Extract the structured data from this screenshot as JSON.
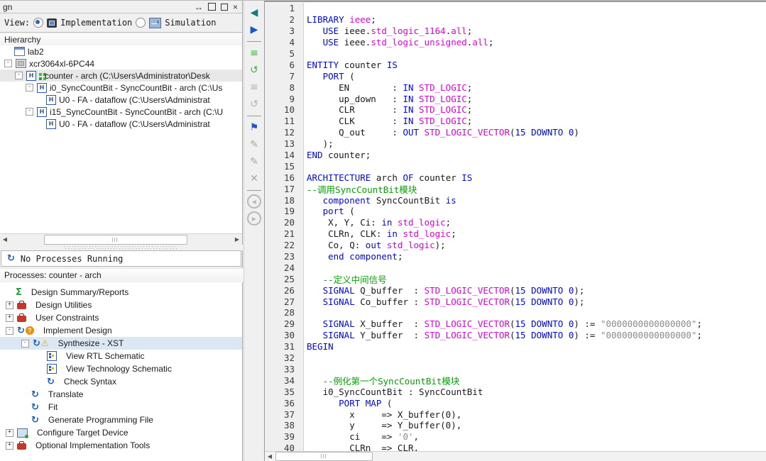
{
  "window": {
    "title_fragment": "gn",
    "buttons": [
      "float",
      "maximize",
      "restore",
      "close"
    ]
  },
  "view_bar": {
    "label": "View:",
    "options": [
      {
        "label": "Implementation",
        "selected": true,
        "icon": "implementation-chip-icon"
      },
      {
        "label": "Simulation",
        "selected": false,
        "icon": "simulation-icon"
      }
    ]
  },
  "hierarchy": {
    "header": "Hierarchy",
    "items": [
      {
        "label": "lab2",
        "depth": 1,
        "icon": "project",
        "expander": "none",
        "selected": false
      },
      {
        "label": "xcr3064xl-6PC44",
        "depth": 1,
        "icon": "device",
        "expander": "minus",
        "selected": false
      },
      {
        "label": "counter - arch (C:\\Users\\Administrator\\Desk",
        "depth": 2,
        "icon": "vhdl-top",
        "expander": "minus",
        "selected": true
      },
      {
        "label": "i0_SyncCountBit - SyncCountBit - arch (C:\\Us",
        "depth": 3,
        "icon": "vhdl",
        "expander": "minus",
        "selected": false
      },
      {
        "label": "U0 - FA - dataflow (C:\\Users\\Administrat",
        "depth": 4,
        "icon": "vhdl",
        "expander": "none",
        "selected": false
      },
      {
        "label": "i15_SyncCountBit - SyncCountBit - arch (C:\\U",
        "depth": 3,
        "icon": "vhdl",
        "expander": "minus",
        "selected": false
      },
      {
        "label": "U0 - FA - dataflow (C:\\Users\\Administrat",
        "depth": 4,
        "icon": "vhdl",
        "expander": "none",
        "selected": false
      }
    ]
  },
  "status": {
    "text": "No Processes Running",
    "icon": "refresh-icon"
  },
  "processes": {
    "header": "Processes: counter - arch",
    "items": [
      {
        "label": "Design Summary/Reports",
        "depth": 1,
        "icons": [
          "sigma"
        ],
        "expander": "none",
        "selected": false
      },
      {
        "label": "Design Utilities",
        "depth": 1,
        "icons": [
          "toolbox"
        ],
        "expander": "plus",
        "selected": false
      },
      {
        "label": "User Constraints",
        "depth": 1,
        "icons": [
          "toolbox"
        ],
        "expander": "plus",
        "selected": false
      },
      {
        "label": "Implement Design",
        "depth": 1,
        "icons": [
          "refresh",
          "question"
        ],
        "expander": "minus",
        "selected": false
      },
      {
        "label": "Synthesize - XST",
        "depth": 2,
        "icons": [
          "refresh",
          "warning"
        ],
        "expander": "minus",
        "selected": true
      },
      {
        "label": "View RTL Schematic",
        "depth": 3,
        "icons": [
          "schematic"
        ],
        "expander": "none",
        "selected": false
      },
      {
        "label": "View Technology Schematic",
        "depth": 3,
        "icons": [
          "schematic"
        ],
        "expander": "none",
        "selected": false
      },
      {
        "label": "Check Syntax",
        "depth": 3,
        "icons": [
          "refresh"
        ],
        "expander": "none",
        "selected": false
      },
      {
        "label": "Translate",
        "depth": 2,
        "icons": [
          "refresh"
        ],
        "expander": "none",
        "selected": false
      },
      {
        "label": "Fit",
        "depth": 2,
        "icons": [
          "refresh"
        ],
        "expander": "none",
        "selected": false
      },
      {
        "label": "Generate Programming File",
        "depth": 2,
        "icons": [
          "refresh"
        ],
        "expander": "none",
        "selected": false
      },
      {
        "label": "Configure Target Device",
        "depth": 1,
        "icons": [
          "target"
        ],
        "expander": "plus",
        "selected": false
      },
      {
        "label": "Optional Implementation Tools",
        "depth": 1,
        "icons": [
          "toolbox"
        ],
        "expander": "plus",
        "selected": false
      }
    ]
  },
  "editor_toolbar": {
    "items": [
      {
        "name": "goto-previous-icon",
        "glyph": "◀",
        "color": "#1a7a73"
      },
      {
        "name": "goto-next-icon",
        "glyph": "▶",
        "color": "#1a56c8"
      },
      {
        "name": "separator"
      },
      {
        "name": "process-properties-icon",
        "glyph": "≡",
        "color": "#3cb43c"
      },
      {
        "name": "reset-process-icon",
        "glyph": "↺",
        "color": "#3cb43c"
      },
      {
        "name": "process-properties-disabled-icon",
        "glyph": "≡",
        "color": "#b4b4b4"
      },
      {
        "name": "reset-all-disabled-icon",
        "glyph": "↺",
        "color": "#b4b4b4"
      },
      {
        "name": "separator"
      },
      {
        "name": "flag-icon",
        "glyph": "⚑",
        "color": "#2255cc"
      },
      {
        "name": "edit-marker-disabled-icon",
        "glyph": "✎",
        "color": "#a8a8a8"
      },
      {
        "name": "edit-marker2-disabled-icon",
        "glyph": "✎",
        "color": "#a8a8a8"
      },
      {
        "name": "delete-marker-disabled-icon",
        "glyph": "✕",
        "color": "#a8a8a8"
      },
      {
        "name": "separator"
      },
      {
        "name": "nav-back-icon",
        "glyph": "◀",
        "circle": true
      },
      {
        "name": "nav-forward-icon",
        "glyph": "▶",
        "circle": true
      }
    ]
  },
  "editor": {
    "language": "VHDL",
    "lines": [
      {
        "n": 1,
        "segs": []
      },
      {
        "n": 2,
        "segs": [
          [
            "LIBRARY ",
            "k"
          ],
          [
            "ieee",
            "t"
          ],
          [
            ";",
            "p"
          ]
        ]
      },
      {
        "n": 3,
        "segs": [
          [
            "   ",
            "p"
          ],
          [
            "USE ",
            "k"
          ],
          [
            "ieee.",
            "p"
          ],
          [
            "std_logic_1164",
            "t"
          ],
          [
            ".",
            "p"
          ],
          [
            "all",
            "t"
          ],
          [
            ";",
            "p"
          ]
        ]
      },
      {
        "n": 4,
        "segs": [
          [
            "   ",
            "p"
          ],
          [
            "USE ",
            "k"
          ],
          [
            "ieee.",
            "p"
          ],
          [
            "std_logic_unsigned",
            "t"
          ],
          [
            ".",
            "p"
          ],
          [
            "all",
            "t"
          ],
          [
            ";",
            "p"
          ]
        ]
      },
      {
        "n": 5,
        "segs": []
      },
      {
        "n": 6,
        "segs": [
          [
            "ENTITY ",
            "k"
          ],
          [
            "counter ",
            "p"
          ],
          [
            "IS",
            "k"
          ]
        ]
      },
      {
        "n": 7,
        "segs": [
          [
            "   ",
            "p"
          ],
          [
            "PORT ",
            "k"
          ],
          [
            "(",
            "p"
          ]
        ]
      },
      {
        "n": 8,
        "segs": [
          [
            "      EN        : ",
            "p"
          ],
          [
            "IN ",
            "k"
          ],
          [
            "STD_LOGIC",
            "t"
          ],
          [
            ";",
            "p"
          ]
        ]
      },
      {
        "n": 9,
        "segs": [
          [
            "      up_down   : ",
            "p"
          ],
          [
            "IN ",
            "k"
          ],
          [
            "STD_LOGIC",
            "t"
          ],
          [
            ";",
            "p"
          ]
        ]
      },
      {
        "n": 10,
        "segs": [
          [
            "      CLR       : ",
            "p"
          ],
          [
            "IN ",
            "k"
          ],
          [
            "STD_LOGIC",
            "t"
          ],
          [
            ";",
            "p"
          ]
        ]
      },
      {
        "n": 11,
        "segs": [
          [
            "      CLK       : ",
            "p"
          ],
          [
            "IN ",
            "k"
          ],
          [
            "STD_LOGIC",
            "t"
          ],
          [
            ";",
            "p"
          ]
        ]
      },
      {
        "n": 12,
        "segs": [
          [
            "      Q_out     : ",
            "p"
          ],
          [
            "OUT ",
            "k"
          ],
          [
            "STD_LOGIC_VECTOR",
            "t"
          ],
          [
            "(",
            "p"
          ],
          [
            "15",
            "n"
          ],
          [
            " ",
            "p"
          ],
          [
            "DOWNTO ",
            "k"
          ],
          [
            "0",
            "n"
          ],
          [
            ")",
            "p"
          ]
        ]
      },
      {
        "n": 13,
        "segs": [
          [
            "   );",
            "p"
          ]
        ]
      },
      {
        "n": 14,
        "segs": [
          [
            "END ",
            "k"
          ],
          [
            "counter;",
            "p"
          ]
        ]
      },
      {
        "n": 15,
        "segs": []
      },
      {
        "n": 16,
        "segs": [
          [
            "ARCHITECTURE ",
            "k"
          ],
          [
            "arch ",
            "p"
          ],
          [
            "OF ",
            "k"
          ],
          [
            "counter ",
            "p"
          ],
          [
            "IS",
            "k"
          ]
        ]
      },
      {
        "n": 17,
        "segs": [
          [
            "--调用SyncCountBit模块",
            "c"
          ]
        ]
      },
      {
        "n": 18,
        "segs": [
          [
            "   ",
            "p"
          ],
          [
            "component ",
            "k"
          ],
          [
            "SyncCountBit ",
            "p"
          ],
          [
            "is",
            "k"
          ]
        ]
      },
      {
        "n": 19,
        "segs": [
          [
            "   ",
            "p"
          ],
          [
            "port ",
            "k"
          ],
          [
            "(",
            "p"
          ]
        ]
      },
      {
        "n": 20,
        "segs": [
          [
            "    X, Y, Ci: ",
            "p"
          ],
          [
            "in ",
            "k"
          ],
          [
            "std_logic",
            "t"
          ],
          [
            ";",
            "p"
          ]
        ]
      },
      {
        "n": 21,
        "segs": [
          [
            "    CLRn, CLK: ",
            "p"
          ],
          [
            "in ",
            "k"
          ],
          [
            "std_logic",
            "t"
          ],
          [
            ";",
            "p"
          ]
        ]
      },
      {
        "n": 22,
        "segs": [
          [
            "    Co, Q: ",
            "p"
          ],
          [
            "out ",
            "k"
          ],
          [
            "std_logic",
            "t"
          ],
          [
            ");",
            "p"
          ]
        ]
      },
      {
        "n": 23,
        "segs": [
          [
            "    ",
            "p"
          ],
          [
            "end component",
            "k"
          ],
          [
            ";",
            "p"
          ]
        ]
      },
      {
        "n": 24,
        "segs": []
      },
      {
        "n": 25,
        "segs": [
          [
            "   ",
            "p"
          ],
          [
            "--定义中间信号",
            "c"
          ]
        ]
      },
      {
        "n": 26,
        "segs": [
          [
            "   ",
            "p"
          ],
          [
            "SIGNAL ",
            "k"
          ],
          [
            "Q_buffer  : ",
            "p"
          ],
          [
            "STD_LOGIC_VECTOR",
            "t"
          ],
          [
            "(",
            "p"
          ],
          [
            "15",
            "n"
          ],
          [
            " ",
            "p"
          ],
          [
            "DOWNTO ",
            "k"
          ],
          [
            "0",
            "n"
          ],
          [
            ");",
            "p"
          ]
        ]
      },
      {
        "n": 27,
        "segs": [
          [
            "   ",
            "p"
          ],
          [
            "SIGNAL ",
            "k"
          ],
          [
            "Co_buffer : ",
            "p"
          ],
          [
            "STD_LOGIC_VECTOR",
            "t"
          ],
          [
            "(",
            "p"
          ],
          [
            "15",
            "n"
          ],
          [
            " ",
            "p"
          ],
          [
            "DOWNTO ",
            "k"
          ],
          [
            "0",
            "n"
          ],
          [
            ");",
            "p"
          ]
        ]
      },
      {
        "n": 28,
        "segs": []
      },
      {
        "n": 29,
        "segs": [
          [
            "   ",
            "p"
          ],
          [
            "SIGNAL ",
            "k"
          ],
          [
            "X_buffer  : ",
            "p"
          ],
          [
            "STD_LOGIC_VECTOR",
            "t"
          ],
          [
            "(",
            "p"
          ],
          [
            "15",
            "n"
          ],
          [
            " ",
            "p"
          ],
          [
            "DOWNTO ",
            "k"
          ],
          [
            "0",
            "n"
          ],
          [
            ") := ",
            "p"
          ],
          [
            "\"0000000000000000\"",
            "s"
          ],
          [
            ";",
            "p"
          ]
        ]
      },
      {
        "n": 30,
        "segs": [
          [
            "   ",
            "p"
          ],
          [
            "SIGNAL ",
            "k"
          ],
          [
            "Y_buffer  : ",
            "p"
          ],
          [
            "STD_LOGIC_VECTOR",
            "t"
          ],
          [
            "(",
            "p"
          ],
          [
            "15",
            "n"
          ],
          [
            " ",
            "p"
          ],
          [
            "DOWNTO ",
            "k"
          ],
          [
            "0",
            "n"
          ],
          [
            ") := ",
            "p"
          ],
          [
            "\"0000000000000000\"",
            "s"
          ],
          [
            ";",
            "p"
          ]
        ]
      },
      {
        "n": 31,
        "segs": [
          [
            "BEGIN",
            "k"
          ]
        ]
      },
      {
        "n": 32,
        "segs": []
      },
      {
        "n": 33,
        "segs": []
      },
      {
        "n": 34,
        "segs": [
          [
            "   ",
            "p"
          ],
          [
            "--例化第一个SyncCountBit模块",
            "c"
          ]
        ]
      },
      {
        "n": 35,
        "segs": [
          [
            "   i0_SyncCountBit : SyncCountBit",
            "p"
          ]
        ]
      },
      {
        "n": 36,
        "segs": [
          [
            "      ",
            "p"
          ],
          [
            "PORT MAP ",
            "k"
          ],
          [
            "(",
            "p"
          ]
        ]
      },
      {
        "n": 37,
        "segs": [
          [
            "        x     => X_buffer(0),",
            "p"
          ]
        ]
      },
      {
        "n": 38,
        "segs": [
          [
            "        y     => Y_buffer(0),",
            "p"
          ]
        ]
      },
      {
        "n": 39,
        "segs": [
          [
            "        ci    => ",
            "p"
          ],
          [
            "'0'",
            "s"
          ],
          [
            ",",
            "p"
          ]
        ]
      },
      {
        "n": 40,
        "segs": [
          [
            "        CLRn  => CLR,",
            "p"
          ]
        ]
      }
    ]
  },
  "colors": {
    "keyword": "#0008dd",
    "type": "#dd00dd",
    "comment": "#00a300",
    "string": "#8a8a8a",
    "selection": "#dbe7f3"
  }
}
